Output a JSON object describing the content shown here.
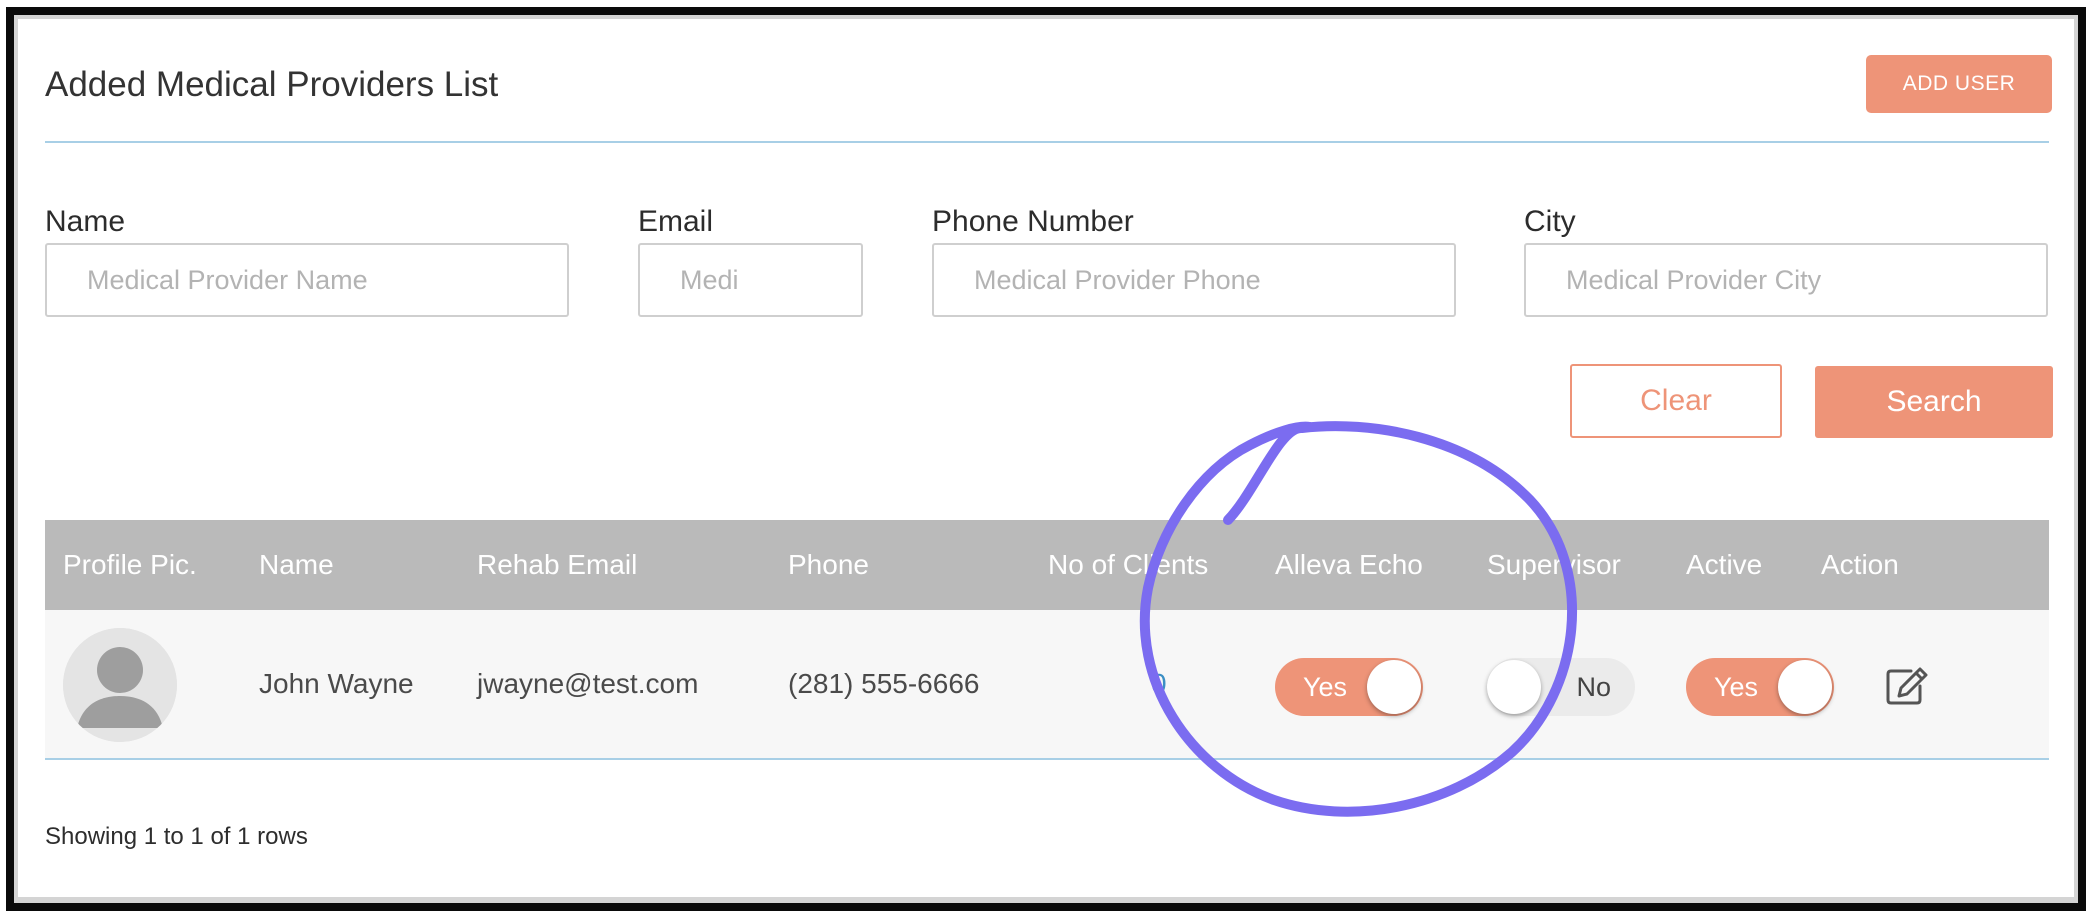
{
  "header": {
    "title": "Added Medical Providers List",
    "add_user_label": "ADD USER"
  },
  "filters": {
    "name": {
      "label": "Name",
      "placeholder": "Medical Provider Name"
    },
    "email": {
      "label": "Email",
      "placeholder": "Medi"
    },
    "phone": {
      "label": "Phone Number",
      "placeholder": "Medical Provider Phone"
    },
    "city": {
      "label": "City",
      "placeholder": "Medical Provider City"
    }
  },
  "actions": {
    "clear_label": "Clear",
    "search_label": "Search"
  },
  "table": {
    "columns": [
      "Profile Pic.",
      "Name",
      "Rehab Email",
      "Phone",
      "No of Clients",
      "Alleva Echo",
      "Supervisor",
      "Active",
      "Action"
    ],
    "rows": [
      {
        "name": "John Wayne",
        "email": "jwayne@test.com",
        "phone": "(281) 555-6666",
        "clients": "0",
        "alleva_echo": "Yes",
        "supervisor": "No",
        "active": "Yes"
      }
    ]
  },
  "footer": {
    "showing_text": "Showing 1 to 1 of 1 rows"
  },
  "colors": {
    "accent": "#ee9478",
    "divider": "#a8cfe6",
    "header_bg": "#bababa",
    "annotation": "#7b6cf0"
  },
  "icons": {
    "edit": "edit-icon",
    "avatar": "avatar-placeholder-icon"
  }
}
